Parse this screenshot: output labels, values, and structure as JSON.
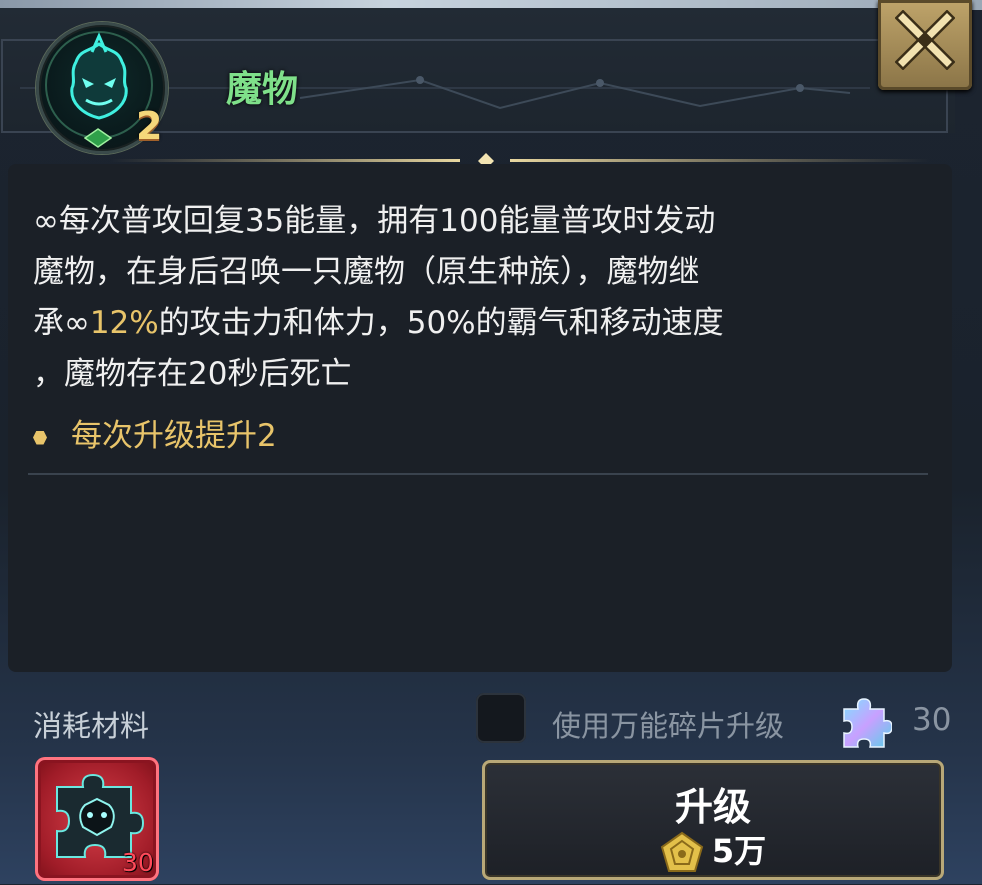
{
  "skill": {
    "title": "魔物",
    "level": "2",
    "description_line1": "∞每次普攻回复35能量，拥有100能量普攻时发动",
    "description_line2": "魔物，在身后召唤一只魔物（原生种族），魔物继",
    "description_line3_pre": "承∞",
    "description_line3_highlight": "12%",
    "description_line3_post": "的攻击力和体力，50%的霸气和移动速度",
    "description_line4": "，魔物存在20秒后死亡",
    "bullet": "每次升级提升2"
  },
  "materials": {
    "label": "消耗材料",
    "item_count": "30"
  },
  "universal": {
    "label": "使用万能碎片升级",
    "count": "30",
    "checked": false
  },
  "upgrade": {
    "label": "升级",
    "cost": "5万"
  },
  "colors": {
    "title": "#7fe08a",
    "highlight": "#e8c46a",
    "button_border": "#b8a878"
  }
}
